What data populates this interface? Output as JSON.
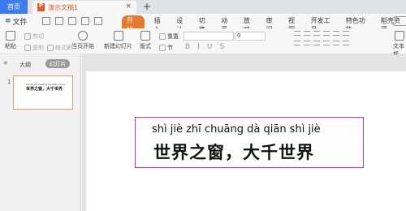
{
  "tabs": {
    "home": "首页",
    "document": "演示文稿1",
    "close_glyph": "×",
    "add_glyph": "+"
  },
  "menubar": {
    "file_label": "文件",
    "items": [
      "开始",
      "插入",
      "设计",
      "切换",
      "动画",
      "放映",
      "审阅",
      "视图",
      "开发工具",
      "特色功能",
      "稻壳资源"
    ],
    "active_index": 0
  },
  "ribbon": {
    "paste": "粘贴",
    "cut": "剪切",
    "copy": "复制",
    "format_painter": "格式刷",
    "play_from_current": "当页开始",
    "new_slide": "新建幻灯片",
    "layout": "版式",
    "section": "节",
    "reset": "重置",
    "font_size_value": "0",
    "text_box": "文本框",
    "font_style_glyphs": [
      "B",
      "I",
      "U",
      "S"
    ]
  },
  "left_panel": {
    "collapse_glyph": "«",
    "outline_label": "大纲",
    "slides_label": "幻灯片",
    "slide_number": "1"
  },
  "slide": {
    "pinyin": "shì jiè zhī chuāng dà qiān shì jiè",
    "hanzi": "世界之窗，大千世界"
  },
  "colors": {
    "accent": "#e57a2e",
    "home_tab": "#3c7cf0",
    "selection_border": "#c9338d"
  }
}
